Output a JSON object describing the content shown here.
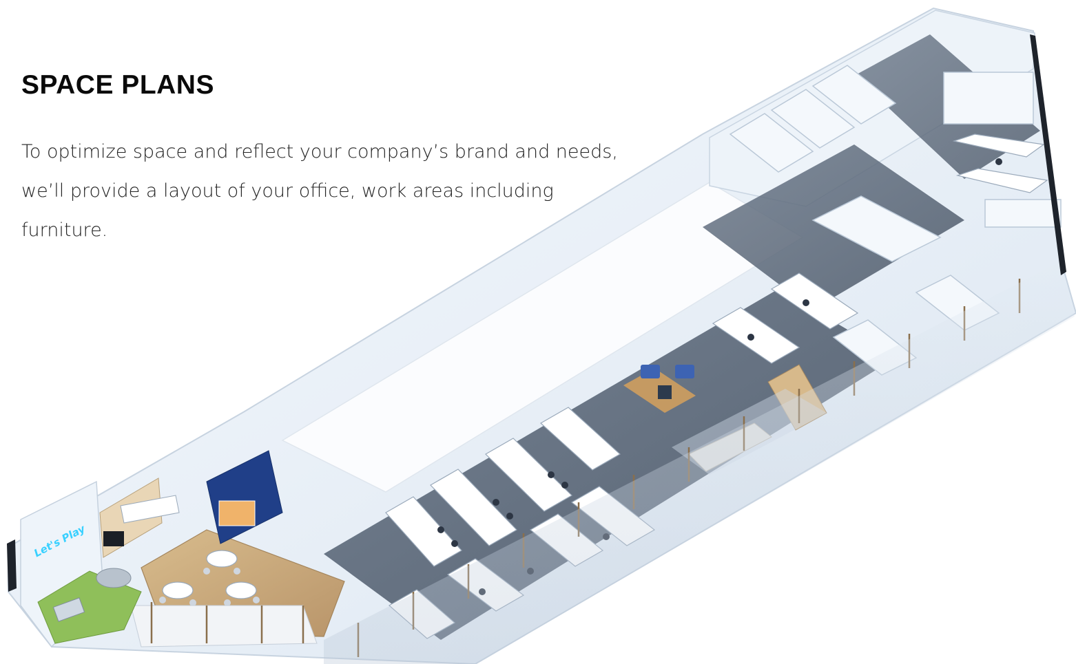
{
  "header": {
    "title": "SPACE PLANS"
  },
  "body": {
    "description": "To optimize space and reflect your company’s brand and needs, we’ll provide a layout of your office, work areas including furniture."
  },
  "illustration": {
    "subject": "isometric office floor plan",
    "neon_sign": "Let's Play",
    "colors": {
      "walls": "#eef4fa",
      "floor_carpet": "#5d6a7a",
      "floor_wood": "#c9a877",
      "turf": "#8fbf5a",
      "accent_blue": "#1f3f88",
      "glass": "#c8d4e2",
      "neon": "#38d0ff"
    }
  }
}
